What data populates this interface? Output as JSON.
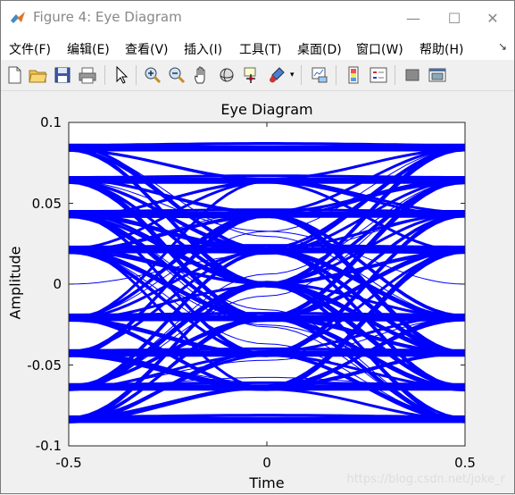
{
  "window": {
    "title": "Figure 4: Eye Diagram",
    "minimize": "—",
    "maximize": "☐",
    "close": "✕"
  },
  "menu": [
    {
      "label": "文件(F)"
    },
    {
      "label": "编辑(E)"
    },
    {
      "label": "查看(V)"
    },
    {
      "label": "插入(I)"
    },
    {
      "label": "工具(T)"
    },
    {
      "label": "桌面(D)"
    },
    {
      "label": "窗口(W)"
    },
    {
      "label": "帮助(H)"
    }
  ],
  "toolbar_icons": [
    "new-figure-icon",
    "open-file-icon",
    "save-icon",
    "print-icon",
    "select-arrow-icon",
    "zoom-in-icon",
    "zoom-out-icon",
    "pan-icon",
    "rotate-3d-icon",
    "data-cursor-icon",
    "brush-icon",
    "brush-dropdown-icon",
    "link-plot-icon",
    "colorbar-icon",
    "legend-icon",
    "hide-plot-tools-icon",
    "show-plot-tools-icon"
  ],
  "watermark": "https://blog.csdn.net/joke_r",
  "chart_data": {
    "type": "line",
    "title": "Eye Diagram",
    "xlabel": "Time",
    "ylabel": "Amplitude",
    "xlim": [
      -0.5,
      0.5
    ],
    "ylim": [
      -0.1,
      0.1
    ],
    "x_ticks": [
      "-0.5",
      "0",
      "0.5"
    ],
    "y_ticks": [
      "0.1",
      "0.05",
      "0",
      "-0.05",
      "-0.1"
    ],
    "line_color": "#0000ff",
    "levels": [
      -0.084,
      -0.064,
      -0.043,
      -0.021,
      0.0,
      0.021,
      0.043,
      0.064,
      0.084
    ],
    "grid": false
  }
}
